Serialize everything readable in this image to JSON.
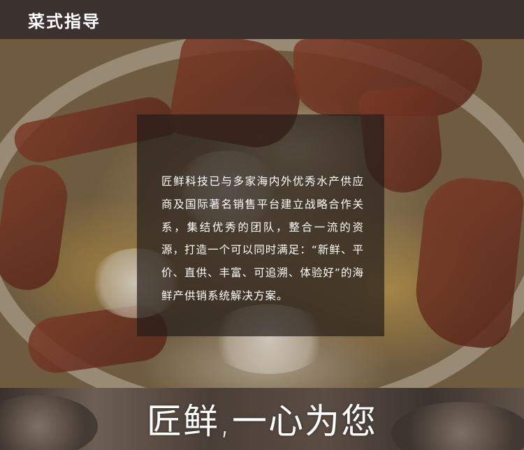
{
  "header": {
    "title": "菜式指导"
  },
  "hero": {
    "image": "lobster-dish-photo",
    "intro": "匠鲜科技已与多家海内外优秀水产供应商及国际著名销售平台建立战略合作关系，集结优秀的团队，整合一流的资源，打造一个可以同时满足：“新鲜、平价、直供、丰富、可追溯、体验好”的海鲜产供销系统解决方案。"
  },
  "footer": {
    "slogan": "匠鲜,一心为您"
  },
  "colors": {
    "header_bg": "#3b3230",
    "text": "#ffffff",
    "panel_bg": "rgba(35,28,24,0.70)"
  }
}
